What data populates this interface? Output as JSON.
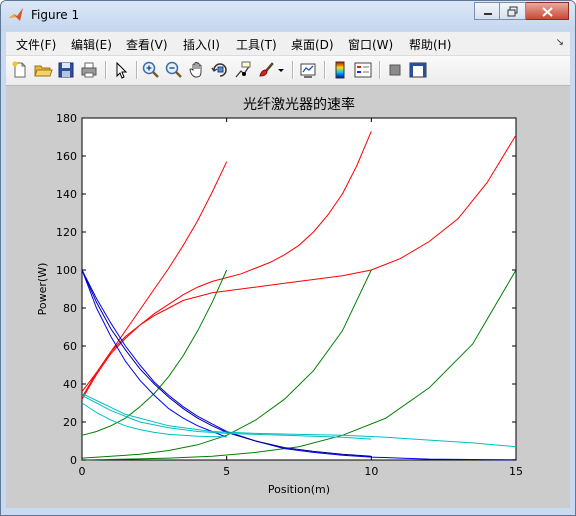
{
  "window": {
    "title": "Figure 1"
  },
  "menu": {
    "items": [
      {
        "label": "文件(F)"
      },
      {
        "label": "编辑(E)"
      },
      {
        "label": "查看(V)"
      },
      {
        "label": "插入(I)"
      },
      {
        "label": "工具(T)"
      },
      {
        "label": "桌面(D)"
      },
      {
        "label": "窗口(W)"
      },
      {
        "label": "帮助(H)"
      }
    ],
    "overflow_icon": "dock-arrow-icon"
  },
  "toolbar": {
    "buttons": [
      {
        "name": "new-figure-button",
        "icon": "new-file-icon"
      },
      {
        "name": "open-file-button",
        "icon": "folder-open-icon"
      },
      {
        "name": "save-button",
        "icon": "floppy-disk-icon"
      },
      {
        "name": "print-button",
        "icon": "printer-icon"
      },
      {
        "name": "edit-plot-button",
        "icon": "arrow-cursor-icon"
      },
      {
        "name": "zoom-in-button",
        "icon": "zoom-in-icon"
      },
      {
        "name": "zoom-out-button",
        "icon": "zoom-out-icon"
      },
      {
        "name": "pan-button",
        "icon": "hand-icon"
      },
      {
        "name": "rotate-3d-button",
        "icon": "rotate-3d-icon"
      },
      {
        "name": "data-cursor-button",
        "icon": "data-cursor-icon"
      },
      {
        "name": "brush-button",
        "icon": "brush-icon"
      },
      {
        "name": "link-plot-button",
        "icon": "link-plot-icon"
      },
      {
        "name": "colorbar-button",
        "icon": "colorbar-icon"
      },
      {
        "name": "legend-button",
        "icon": "legend-icon"
      },
      {
        "name": "hide-plot-tools-button",
        "icon": "hide-tools-icon"
      },
      {
        "name": "show-plot-tools-button",
        "icon": "show-tools-icon"
      }
    ]
  },
  "colors": {
    "red": "#ff0000",
    "green": "#007f00",
    "blue": "#0000ff",
    "navy": "#00007f",
    "cyan": "#00bfbf"
  },
  "chart_data": {
    "type": "line",
    "title": "光纤激光器的速率",
    "xlabel": "Position(m)",
    "ylabel": "Power(W)",
    "xlim": [
      0,
      15
    ],
    "ylim": [
      0,
      180
    ],
    "xticks": [
      "0",
      "5",
      "10",
      "15"
    ],
    "yticks": [
      "0",
      "20",
      "40",
      "60",
      "80",
      "100",
      "120",
      "140",
      "160",
      "180"
    ],
    "grid": false,
    "series": [
      {
        "color": "#ff0000",
        "x": [
          0,
          0.5,
          1,
          1.5,
          2,
          2.5,
          3,
          3.5,
          4,
          4.5,
          5
        ],
        "y": [
          36,
          46,
          57,
          68,
          79,
          90,
          101,
          113,
          126,
          141,
          157
        ]
      },
      {
        "color": "#ff0000",
        "x": [
          0,
          0.5,
          1,
          1.5,
          2,
          2.5,
          3,
          3.5,
          4,
          4.5,
          5,
          5.5,
          6,
          6.5,
          7,
          7.5,
          8,
          8.5,
          9,
          9.5,
          10
        ],
        "y": [
          32,
          45,
          56,
          64,
          71,
          77,
          82,
          87,
          91,
          94,
          96,
          98,
          101,
          104,
          108,
          113,
          120,
          129,
          140,
          155,
          173
        ]
      },
      {
        "color": "#ff0000",
        "x": [
          0,
          0.5,
          1,
          1.5,
          2,
          2.5,
          3,
          3.5,
          4,
          4.5,
          5,
          6,
          7,
          8,
          9,
          10,
          11,
          12,
          13,
          14,
          15
        ],
        "y": [
          33,
          46,
          57,
          65,
          71,
          76,
          80,
          84,
          86,
          88,
          89,
          91,
          93,
          95,
          97,
          100,
          106,
          115,
          127,
          146,
          171
        ]
      },
      {
        "color": "#007f00",
        "x": [
          0,
          0.5,
          1,
          1.5,
          2,
          2.5,
          3,
          3.5,
          4,
          4.5,
          5
        ],
        "y": [
          13,
          15,
          18,
          22,
          28,
          35,
          44,
          55,
          68,
          83,
          100
        ]
      },
      {
        "color": "#007f00",
        "x": [
          0,
          1,
          2,
          3,
          4,
          5,
          6,
          7,
          8,
          9,
          10
        ],
        "y": [
          1,
          2,
          3,
          5,
          8,
          13,
          21,
          32,
          47,
          68,
          100
        ]
      },
      {
        "color": "#007f00",
        "x": [
          0,
          1.5,
          3,
          4.5,
          6,
          7.5,
          9,
          10.5,
          12,
          13.5,
          15
        ],
        "y": [
          0,
          0.5,
          1,
          2,
          4,
          7,
          13,
          22,
          38,
          61,
          100
        ]
      },
      {
        "color": "#0000ff",
        "x": [
          0,
          0.5,
          1,
          1.5,
          2,
          2.5,
          3,
          3.5,
          4,
          4.5,
          5,
          6,
          7,
          8,
          9,
          10,
          11,
          12,
          13,
          14,
          15
        ],
        "y": [
          100,
          85,
          72,
          60,
          50,
          41,
          34,
          28,
          23,
          19,
          15,
          10,
          6,
          4,
          2.5,
          1.5,
          1,
          0.5,
          0.3,
          0.2,
          0.1
        ]
      },
      {
        "color": "#00007f",
        "x": [
          0,
          0.5,
          1,
          1.5,
          2,
          2.5,
          3,
          3.5,
          4,
          4.5,
          5,
          6,
          7,
          8,
          9,
          10
        ],
        "y": [
          100,
          83,
          69,
          58,
          48,
          40,
          33,
          27,
          22,
          18,
          14.5,
          10,
          6.5,
          4.5,
          3,
          2
        ]
      },
      {
        "color": "#0000ff",
        "x": [
          0,
          0.5,
          1,
          1.5,
          2,
          2.5,
          3,
          3.5,
          4,
          4.5,
          5
        ],
        "y": [
          100,
          80,
          65,
          52,
          42,
          34,
          27,
          22,
          18,
          15,
          12
        ]
      },
      {
        "color": "#00bfbf",
        "x": [
          0,
          0.5,
          1,
          1.5,
          2,
          2.5,
          3,
          3.5,
          4,
          4.5,
          5
        ],
        "y": [
          30,
          25,
          21,
          18,
          16,
          14.5,
          13.5,
          13,
          12.5,
          12.3,
          12.2
        ]
      },
      {
        "color": "#00bfbf",
        "x": [
          0,
          1,
          2,
          3,
          4,
          5,
          6,
          7,
          8,
          9,
          10
        ],
        "y": [
          34,
          26,
          20,
          17,
          15,
          14,
          13.5,
          13,
          12.5,
          12,
          11
        ]
      },
      {
        "color": "#00bfbf",
        "x": [
          0,
          1.5,
          3,
          4.5,
          6,
          7.5,
          9,
          10.5,
          12,
          13.5,
          15
        ],
        "y": [
          35,
          24,
          18,
          15,
          14,
          13.5,
          13,
          12,
          10.5,
          9,
          7
        ]
      }
    ]
  }
}
